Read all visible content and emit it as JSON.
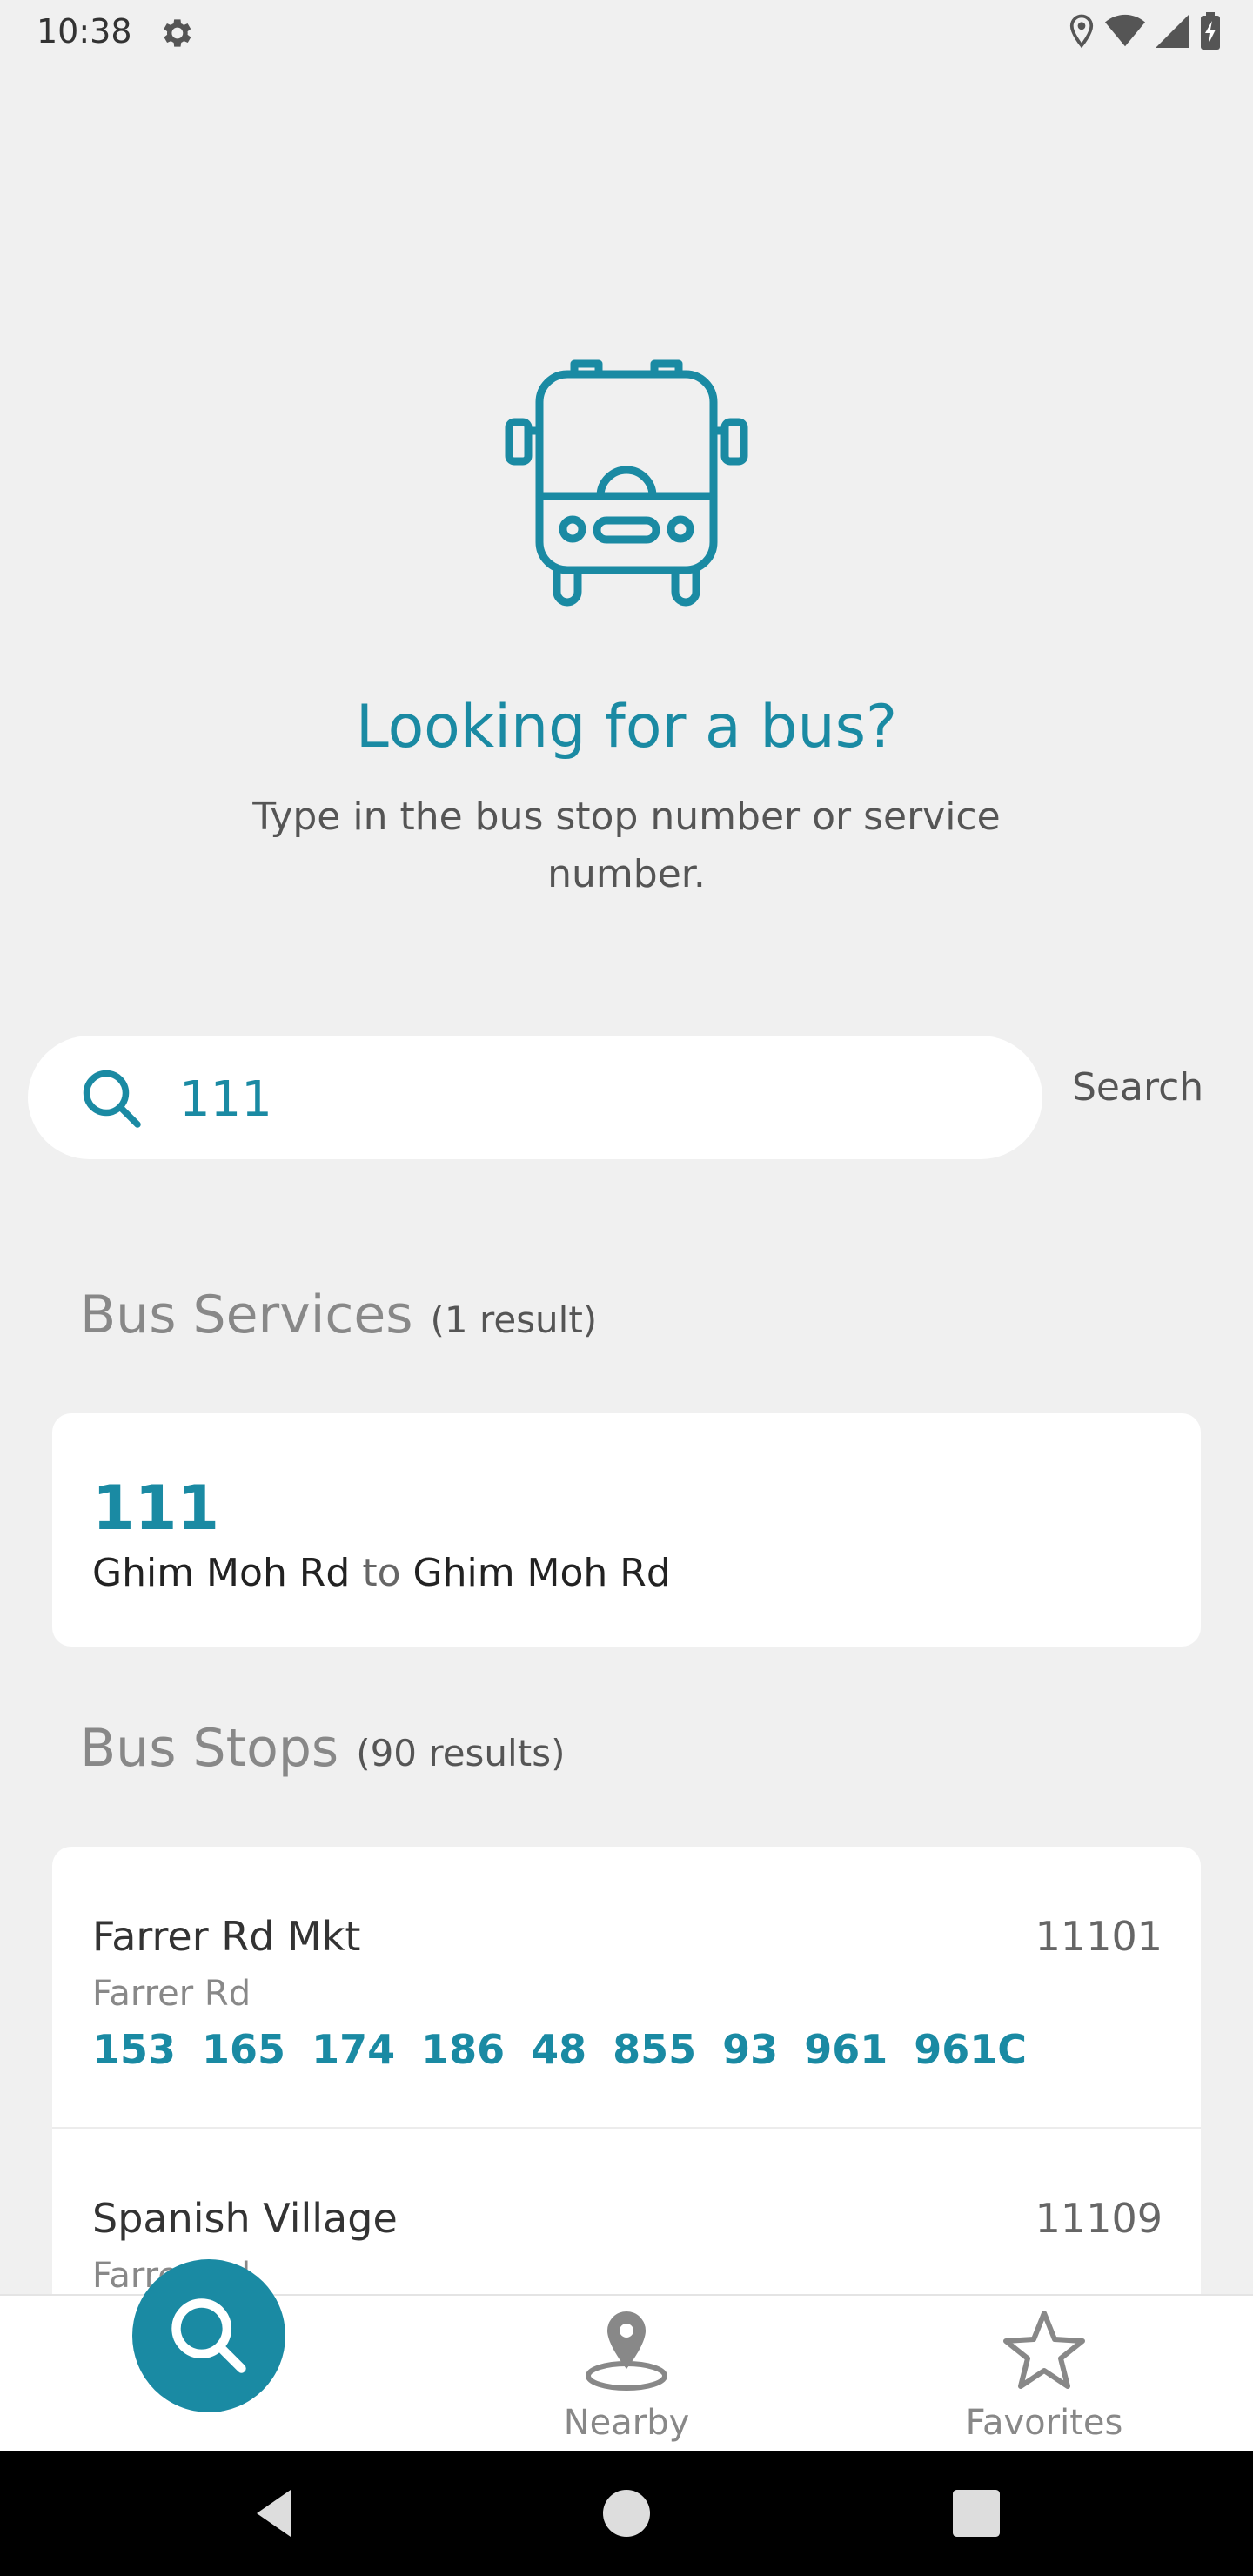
{
  "status_bar": {
    "time": "10:38"
  },
  "hero": {
    "title": "Looking for a bus?",
    "subtitle": "Type in the bus stop number or service number."
  },
  "search": {
    "value": "111",
    "action_label": "Search"
  },
  "bus_services": {
    "title": "Bus Services",
    "count_label": "(1 result)",
    "items": [
      {
        "number": "111",
        "from": "Ghim Moh Rd",
        "to_word": "to",
        "to": "Ghim Moh Rd"
      }
    ]
  },
  "bus_stops": {
    "title": "Bus Stops",
    "count_label": "(90 results)",
    "items": [
      {
        "name": "Farrer Rd Mkt",
        "code": "11101",
        "road": "Farrer Rd",
        "services": [
          "153",
          "165",
          "174",
          "186",
          "48",
          "855",
          "93",
          "961",
          "961C"
        ]
      },
      {
        "name": "Spanish Village",
        "code": "11109",
        "road": "Farrer Rd"
      }
    ]
  },
  "bottom_nav": {
    "items": [
      {
        "label": "Nearby",
        "icon": "map-pin-icon"
      },
      {
        "label": "Favorites",
        "icon": "star-icon"
      }
    ],
    "active": "search"
  },
  "colors": {
    "accent": "#1a8aa3",
    "background": "#f0f0f0"
  }
}
